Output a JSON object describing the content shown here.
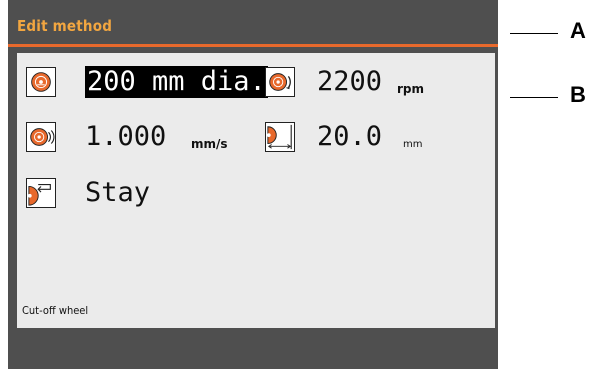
{
  "window": {
    "title": "Edit method"
  },
  "params": {
    "wheel_diameter": {
      "value": "200 mm dia.",
      "icon": "wheel-diameter-icon",
      "selected": true
    },
    "speed": {
      "value": "2200",
      "unit": "rpm",
      "icon": "wheel-rotation-icon"
    },
    "feed": {
      "value": "1.000",
      "unit": "mm/s",
      "icon": "feed-speed-icon"
    },
    "distance": {
      "value": "20.0",
      "unit": "mm",
      "icon": "cut-distance-icon"
    },
    "return_mode": {
      "value": "Stay",
      "icon": "wheel-return-icon"
    }
  },
  "footer": {
    "label": "Cut-off wheel"
  },
  "callouts": {
    "a": "A",
    "b": "B"
  },
  "colors": {
    "accent": "#e8692c",
    "title": "#f2a640",
    "frame": "#4f4f4f",
    "screen": "#ebebeb",
    "selection": "#000000"
  }
}
